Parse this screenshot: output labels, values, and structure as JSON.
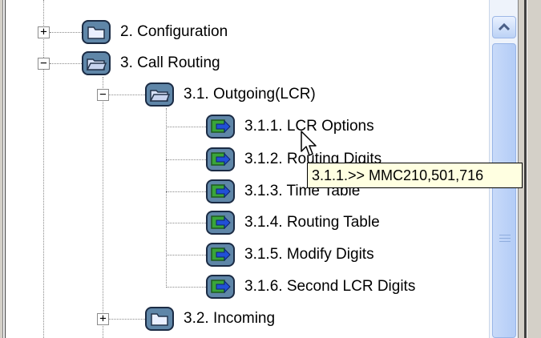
{
  "tree": {
    "nodes": [
      {
        "id": "n2",
        "label": "2. Configuration",
        "expander": "+"
      },
      {
        "id": "n3",
        "label": "3. Call Routing",
        "expander": "−"
      },
      {
        "id": "n31",
        "label": "3.1. Outgoing(LCR)",
        "expander": "−"
      },
      {
        "id": "n311",
        "label": "3.1.1. LCR Options"
      },
      {
        "id": "n312",
        "label": "3.1.2. Routing Digits"
      },
      {
        "id": "n313",
        "label": "3.1.3. Time Table"
      },
      {
        "id": "n314",
        "label": "3.1.4. Routing Table"
      },
      {
        "id": "n315",
        "label": "3.1.5. Modify Digits"
      },
      {
        "id": "n316",
        "label": "3.1.6. Second LCR Digits"
      },
      {
        "id": "n32",
        "label": "3.2. Incoming",
        "expander": "+"
      }
    ]
  },
  "tooltip": {
    "text": "3.1.1.>> MMC210,501,716"
  },
  "icons": {
    "folder": "folder-icon",
    "item": "green-arrow-page-icon",
    "cursor": "mouse-pointer-icon",
    "scroll_up": "chevron-up-icon"
  },
  "colors": {
    "tooltip_bg": "#ffffe1",
    "scrollbar": "#b3ccf6"
  }
}
